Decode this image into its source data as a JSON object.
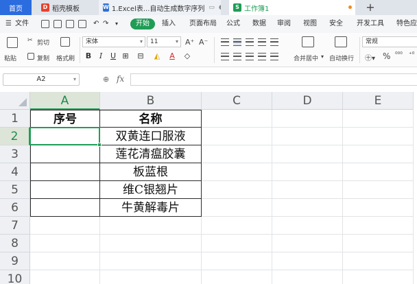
{
  "tabs": {
    "home": "首页",
    "template": "稻壳模板",
    "doc": "1.Excel表...自动生成数字序列",
    "workbook": "工作簿1",
    "new_tab": "+"
  },
  "menu": {
    "file": "文件",
    "start": "开始",
    "insert": "插入",
    "page_layout": "页面布局",
    "formulas": "公式",
    "data": "数据",
    "review": "审阅",
    "view": "视图",
    "security": "安全",
    "developer": "开发工具",
    "special": "特色应"
  },
  "ribbon": {
    "paste": "粘贴",
    "cut": "剪切",
    "copy": "复制",
    "format_painter": "格式刷",
    "font_name": "宋体",
    "font_size": "11",
    "bold": "B",
    "italic": "I",
    "underline": "U",
    "merge_center": "合并居中",
    "wrap_text": "自动换行",
    "number_format": "常规",
    "percent": "%"
  },
  "formula_bar": {
    "name_box": "A2",
    "fx_label": "fx",
    "value": ""
  },
  "sheet": {
    "columns": [
      "A",
      "B",
      "C",
      "D",
      "E"
    ],
    "rows": [
      "1",
      "2",
      "3",
      "4",
      "5",
      "6",
      "7",
      "8",
      "9",
      "10"
    ],
    "selected_column": "A",
    "selected_row": "2",
    "active_cell": "A2",
    "table": {
      "headers": [
        "序号",
        "名称"
      ],
      "rows": [
        [
          "",
          "双黄连口服液"
        ],
        [
          "",
          "莲花清瘟胶囊"
        ],
        [
          "",
          "板蓝根"
        ],
        [
          "",
          "维C银翘片"
        ],
        [
          "",
          "牛黄解毒片"
        ]
      ]
    }
  },
  "colors": {
    "accent_green": "#1f9d55",
    "home_tab": "#2b6cde",
    "unsaved_dot": "#f08a24"
  }
}
